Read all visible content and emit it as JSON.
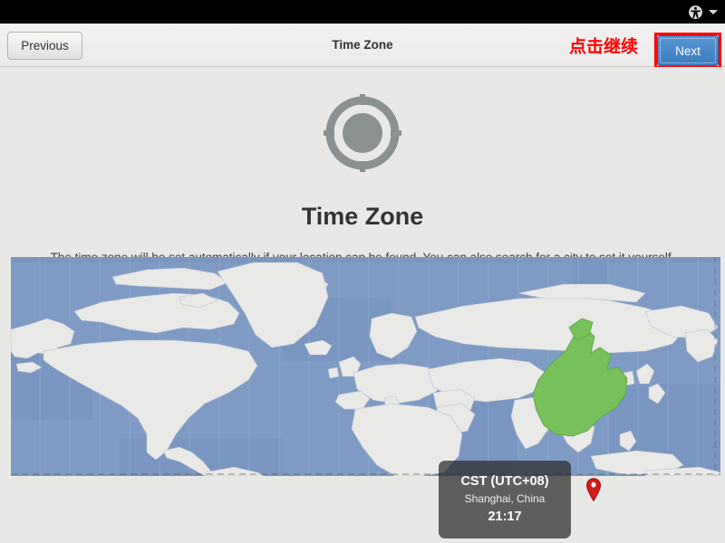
{
  "topbar": {
    "accessibility_icon": "universal-access-icon",
    "dropdown_icon": "chevron-down-icon"
  },
  "header": {
    "title": "Time Zone",
    "previous_label": "Previous",
    "next_label": "Next",
    "annotation_text": "点击继续",
    "annotation_color": "#ff0000",
    "next_button_color": "#3a7cc0"
  },
  "main": {
    "icon": "location-target-icon",
    "title": "Time Zone",
    "description": "The time zone will be set automatically if your location can be found. You can also search for a city to set it yourself.",
    "search": {
      "icon": "search-icon",
      "value": "",
      "placeholder": ""
    }
  },
  "map": {
    "ocean_color": "#7e9bc4",
    "land_color": "#e9e9e7",
    "highlight_color": "#77c05a",
    "pin_color": "#d41b1b",
    "pin_icon": "map-pin-icon",
    "tooltip": {
      "timezone_abbr": "CST (UTC+08)",
      "city": "Shanghai, China",
      "time": "21:17"
    }
  }
}
